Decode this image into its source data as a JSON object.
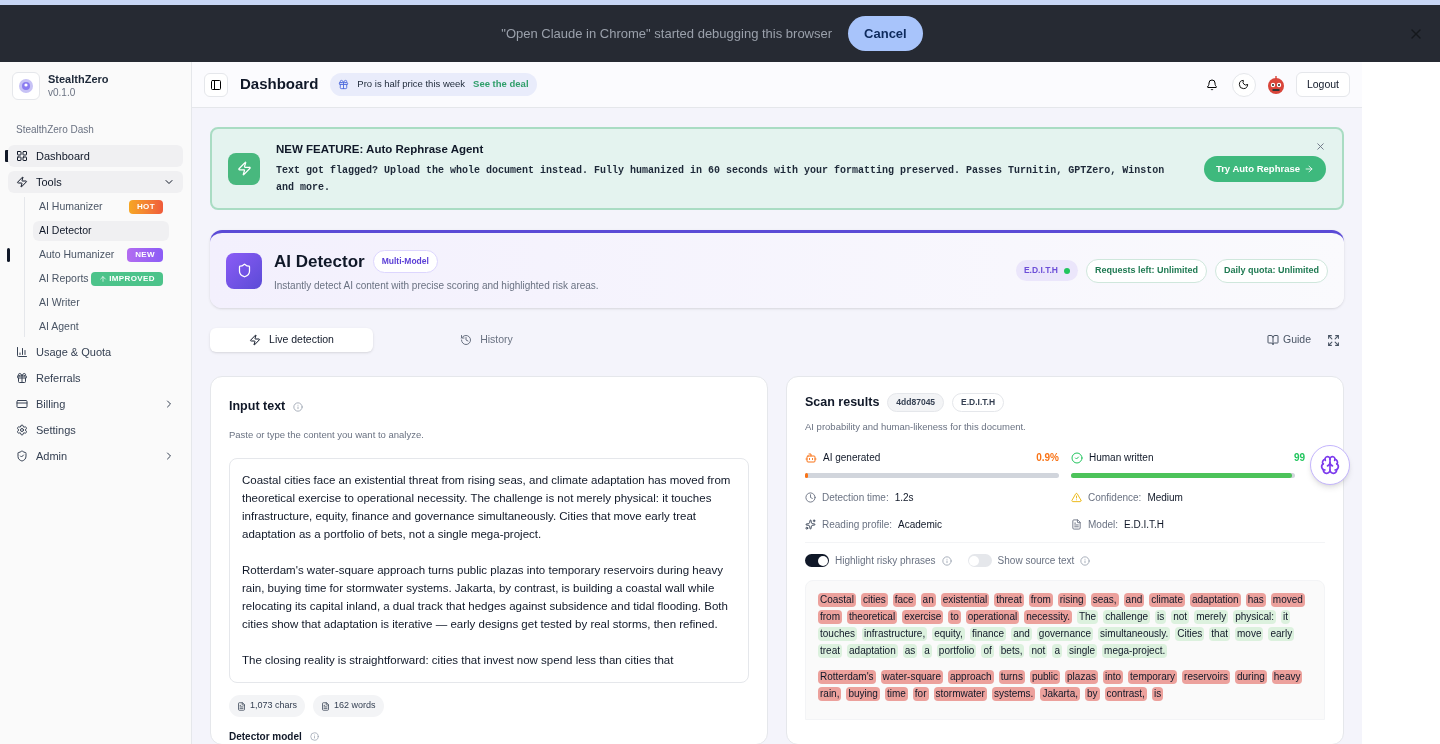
{
  "debug_bar": {
    "message": "\"Open Claude in Chrome\" started debugging this browser",
    "cancel": "Cancel"
  },
  "sidebar": {
    "app_name": "StealthZero",
    "version": "v0.1.0",
    "section": "StealthZero Dash",
    "items": [
      {
        "label": "Dashboard",
        "selected": true,
        "indicator": true
      },
      {
        "label": "Tools",
        "selected": true,
        "indicator": false,
        "expanded": true,
        "children": [
          {
            "label": "AI Humanizer",
            "selected": false,
            "indicator": false,
            "badge": {
              "text": "HOT",
              "kind": "hot"
            }
          },
          {
            "label": "AI Detector",
            "selected": true,
            "indicator": false
          },
          {
            "label": "Auto Humanizer",
            "selected": false,
            "indicator": true,
            "badge": {
              "text": "NEW",
              "kind": "new"
            }
          },
          {
            "label": "AI Reports",
            "selected": false,
            "indicator": false,
            "badge": {
              "text": "IMPROVED",
              "kind": "improved"
            }
          },
          {
            "label": "AI Writer",
            "selected": false,
            "indicator": false
          },
          {
            "label": "AI Agent",
            "selected": false,
            "indicator": false
          }
        ]
      },
      {
        "label": "Usage & Quota",
        "selected": false,
        "indicator": false
      },
      {
        "label": "Referrals",
        "selected": false,
        "indicator": false
      },
      {
        "label": "Billing",
        "selected": false,
        "indicator": false,
        "expanded": false
      },
      {
        "label": "Settings",
        "selected": false,
        "indicator": false
      },
      {
        "label": "Admin",
        "selected": false,
        "indicator": false,
        "expanded": false
      }
    ]
  },
  "header": {
    "title": "Dashboard",
    "promo": "Pro is half price this week",
    "promo_link": "See the deal",
    "logout": "Logout"
  },
  "announcement": {
    "title": "NEW FEATURE: Auto Rephrase Agent",
    "body": "Text got flagged? Upload the whole document instead. Fully humanized in 60 seconds with your formatting preserved. Passes Turnitin, GPTZero, Winston and more.",
    "button": "Try Auto Rephrase"
  },
  "tool": {
    "title": "AI Detector",
    "tag": "Multi-Model",
    "subtitle": "Instantly detect AI content with precise scoring and highlighted risk areas.",
    "model_chip": "E.D.I.T.H",
    "chips": [
      "Requests left: Unlimited",
      "Daily quota: Unlimited"
    ]
  },
  "tabs": [
    {
      "label": "Live detection",
      "selected": true
    },
    {
      "label": "History",
      "selected": false
    }
  ],
  "actions": {
    "guide": "Guide"
  },
  "input": {
    "title": "Input text",
    "hint": "Paste or type the content you want to analyze.",
    "value": [
      "Coastal cities face an existential threat from rising seas, and climate adaptation has moved from theoretical exercise to operational necessity. The challenge is not merely physical: it touches infrastructure, equity, finance and governance simultaneously. Cities that move early treat adaptation as a portfolio of bets, not a single mega-project.",
      "Rotterdam's water-square approach turns public plazas into temporary reservoirs during heavy rain, buying time for stormwater systems. Jakarta, by contrast, is building a coastal wall while relocating its capital inland, a dual track that hedges against subsidence and tidal flooding. Both cities show that adaptation is iterative — early designs get tested by real storms, then refined.",
      "The closing reality is straightforward: cities that invest now spend less than cities that"
    ],
    "stats": [
      "1,073 chars",
      "162 words"
    ],
    "next_label": "Detector model"
  },
  "results": {
    "title": "Scan results",
    "chips": [
      "4dd87045",
      "E.D.I.T.H"
    ],
    "subtitle": "AI probability and human-likeness for this document.",
    "meters": [
      {
        "kind": "ai",
        "label": "AI generated",
        "reading": "0.9%",
        "level": 0.009
      },
      {
        "kind": "human",
        "label": "Human written",
        "reading": "99",
        "level": 0.99
      }
    ],
    "facts": [
      {
        "label": "Detection time:",
        "value": "1.2s"
      },
      {
        "label": "Confidence:",
        "value": "Medium"
      },
      {
        "label": "Reading profile:",
        "value": "Academic"
      },
      {
        "label": "Model:",
        "value": "E.D.I.T.H"
      }
    ],
    "toggles": [
      {
        "label": "Highlight risky phrases",
        "on": true
      },
      {
        "label": "Show source text",
        "on": false
      }
    ],
    "paragraphs": [
      [
        {
          "text": "Coastal cities face an existential threat from rising seas, and climate adaptation has moved from theoretical exercise to operational necessity.",
          "risky": true
        },
        {
          "text": "The challenge is not merely physical: it touches infrastructure, equity, finance and governance simultaneously. Cities that move early treat adaptation as a portfolio of bets, not a single mega-project.",
          "risky": false
        }
      ],
      [
        {
          "text": "Rotterdam's water-square approach turns public plazas into temporary reservoirs during heavy rain, buying time for stormwater systems. Jakarta, by contrast, is",
          "risky": true
        }
      ]
    ]
  }
}
